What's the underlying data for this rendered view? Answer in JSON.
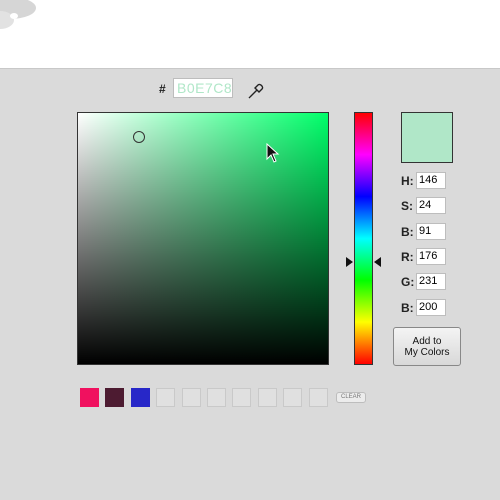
{
  "header": {
    "logo_icon": "site-logo"
  },
  "hex": {
    "prefix": "#",
    "value": "B0E7C8",
    "eyedropper_icon": "eyedropper-icon"
  },
  "picker": {
    "field_hue_color": "#00ff6a",
    "selected_color": "#b0e7c8",
    "marker_icon": "ring-marker",
    "cursor_icon": "mouse-pointer-icon",
    "hue_handle_icons": [
      "arrow-right-icon",
      "arrow-left-icon"
    ]
  },
  "fields": [
    {
      "label": "H:",
      "value": "146"
    },
    {
      "label": "S:",
      "value": "24"
    },
    {
      "label": "B:",
      "value": "91"
    },
    {
      "label": "R:",
      "value": "176"
    },
    {
      "label": "G:",
      "value": "231"
    },
    {
      "label": "B:",
      "value": "200"
    }
  ],
  "add_button": {
    "line1": "Add to",
    "line2": "My Colors"
  },
  "saved_colors": {
    "swatches": [
      "#f0115f",
      "#4d1b31",
      "#2727c8",
      "#e0e0e0",
      "#e0e0e0",
      "#e0e0e0",
      "#e0e0e0",
      "#e0e0e0",
      "#e0e0e0",
      "#e0e0e0"
    ],
    "clear_label": "CLEAR"
  }
}
